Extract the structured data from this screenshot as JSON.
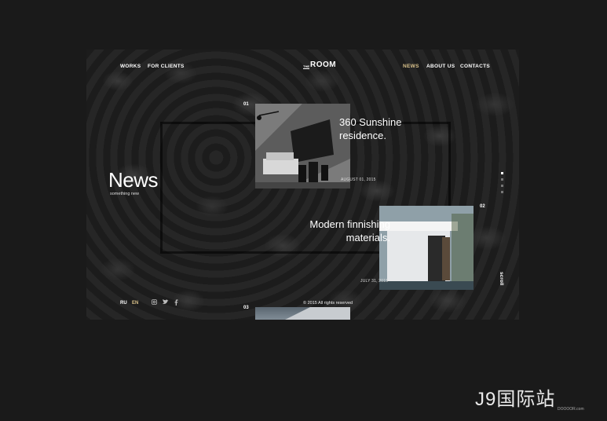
{
  "nav": {
    "works": "WORKS",
    "for_clients": "FOR CLIENTS",
    "logo_small": "THE",
    "logo_main": "ROOM",
    "news": "NEWS",
    "about_us": "ABOUT US",
    "contacts": "CONTACTS",
    "active_color": "#d8c08a"
  },
  "hero": {
    "title": "News",
    "subtitle": "something new"
  },
  "cards": [
    {
      "num": "01",
      "title_line1": "360 Sunshine",
      "title_line2": "residence.",
      "date": "AUGUST 01, 2015"
    },
    {
      "num": "02",
      "title_line1": "Modern finnishing",
      "title_line2": "materials.",
      "date": "JULY 31, 2015"
    },
    {
      "num": "03"
    }
  ],
  "pagination": {
    "count": 4,
    "active_index": 0
  },
  "scroll_label": "scroll",
  "footer": {
    "lang_ru": "RU",
    "lang_en": "EN",
    "lang_active_color": "#d8c08a",
    "social_icons": [
      "instagram-icon",
      "twitter-icon",
      "facebook-icon"
    ],
    "copyright": "© 2015  All rights reserved"
  },
  "watermark": {
    "main": "J9国际站",
    "sub": "DOOOOR.com"
  }
}
